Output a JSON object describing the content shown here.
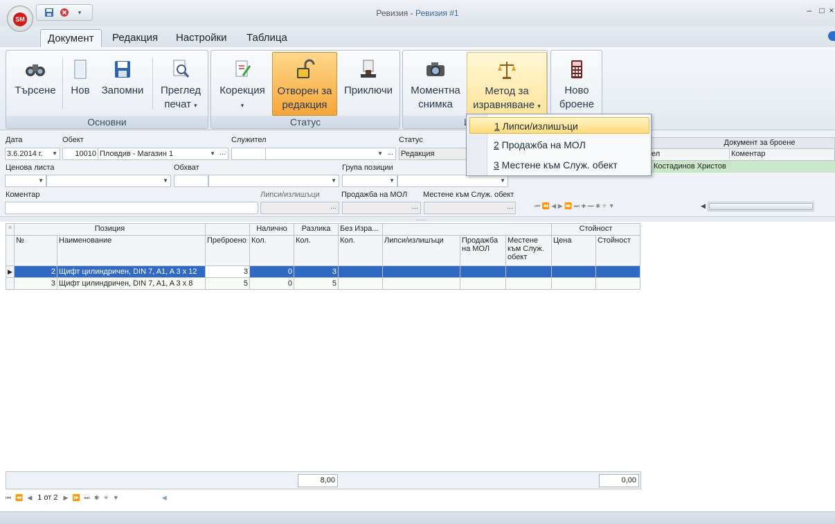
{
  "window": {
    "title_prefix": "Ревизия - ",
    "title_doc": "Ревизия #1",
    "logo_text": "SM"
  },
  "tabs": [
    "Документ",
    "Редакция",
    "Настройки",
    "Таблица"
  ],
  "ribbon": {
    "groups": {
      "basic": "Основни",
      "status": "Статус",
      "compare": "Изра"
    },
    "buttons": {
      "search": "Търсене",
      "new": "Нов",
      "save": "Запомни",
      "preview_l1": "Преглед",
      "preview_l2": "печат",
      "correction": "Корекция",
      "open_l1": "Отворен за",
      "open_l2": "редакция",
      "finish": "Приключи",
      "snapshot_l1": "Моментна",
      "snapshot_l2": "снимка",
      "method_l1": "Метод за",
      "method_l2": "изравняване",
      "newcount_l1": "Ново",
      "newcount_l2": "броене"
    }
  },
  "dropdown_menu": {
    "items": [
      {
        "key": "1",
        "label": " Липси/излишъци"
      },
      {
        "key": "2",
        "label": " Продажба на МОЛ"
      },
      {
        "key": "3",
        "label": " Местене към Служ. обект"
      }
    ]
  },
  "form": {
    "date_label": "Дата",
    "date_value": "3.6.2014 г.",
    "object_label": "Обект",
    "object_code": "10010",
    "object_name": "Пловдив - Магазин 1",
    "employee_label": "Служител",
    "status_label": "Статус",
    "status_value": "Редакция",
    "price_list_label": "Ценова листа",
    "scope_label": "Обхват",
    "item_group_label": "Група позиции",
    "comment_label": "Коментар",
    "shortage_label": "Липси/излишъци",
    "sale_mol_label": "Продажба на МОЛ",
    "move_label": "Местене към Служ. обект"
  },
  "count_doc": {
    "header": "Документ за броене",
    "col_employee_partial": "ел",
    "col_comment": "Коментар",
    "row_employee": "Костадинов Христов"
  },
  "grid": {
    "top_headers": {
      "position": "Позиция",
      "available": "Налично",
      "difference": "Разлика",
      "no_eq": "Без Изра...",
      "value": "Стойност"
    },
    "headers": {
      "no": "№",
      "name": "Наименование",
      "counted": "Преброено",
      "avail_qty": "Кол.",
      "diff_qty": "Кол.",
      "noeq_qty": "Кол.",
      "shortage": "Липси/излишъци",
      "sale_mol": "Продажба на МОЛ",
      "move": "Местене към Служ. обект",
      "price": "Цена",
      "value": "Стойност"
    },
    "rows": [
      {
        "no": "2",
        "name": "Щифт цилиндричен, DIN 7, A1,  A 3 x 12",
        "counted": "3",
        "avail": "0",
        "diff": "3"
      },
      {
        "no": "3",
        "name": "Щифт цилиндричен, DIN 7, A1,  A 3 x 8",
        "counted": "5",
        "avail": "0",
        "diff": "5"
      }
    ],
    "total_diff": "8,00",
    "total_value": "0,00",
    "record": "1 от 2"
  },
  "colors": {
    "selection": "#316ac5",
    "accent_orange": "#f4a63a",
    "status_green": "#c8e6c8"
  }
}
